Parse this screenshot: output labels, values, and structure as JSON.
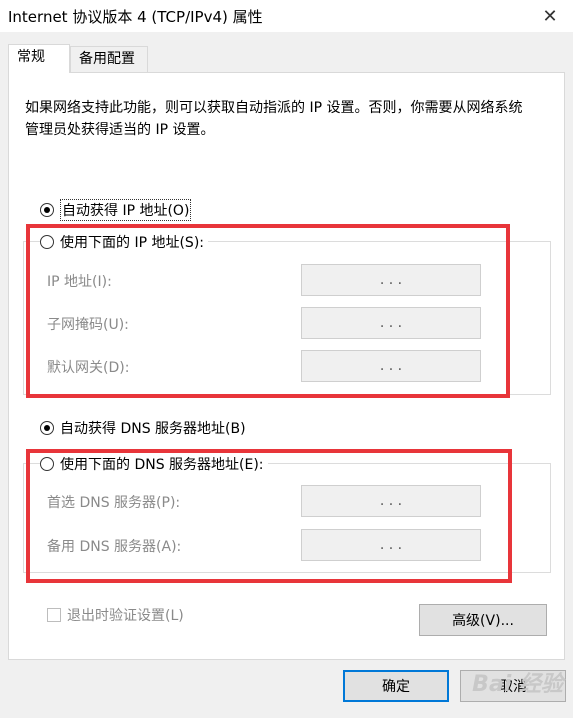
{
  "window": {
    "title": "Internet 协议版本 4 (TCP/IPv4) 属性",
    "close_glyph": "✕"
  },
  "tabs": [
    {
      "label": "常规"
    },
    {
      "label": "备用配置"
    }
  ],
  "description": "如果网络支持此功能，则可以获取自动指派的 IP 设置。否则，你需要从网络系统管理员处获得适当的 IP 设置。",
  "ip": {
    "auto_label": "自动获得 IP 地址(O)",
    "manual_label": "使用下面的 IP 地址(S):",
    "fields": [
      {
        "label": "IP 地址(I):",
        "value": ".   .   ."
      },
      {
        "label": "子网掩码(U):",
        "value": ".   .   ."
      },
      {
        "label": "默认网关(D):",
        "value": ".   .   ."
      }
    ]
  },
  "dns": {
    "auto_label": "自动获得 DNS 服务器地址(B)",
    "manual_label": "使用下面的 DNS 服务器地址(E):",
    "fields": [
      {
        "label": "首选 DNS 服务器(P):",
        "value": ".   .   ."
      },
      {
        "label": "备用 DNS 服务器(A):",
        "value": ".   .   ."
      }
    ]
  },
  "validate_label": "退出时验证设置(L)",
  "advanced_label": "高级(V)...",
  "ok_label": "确定",
  "cancel_label": "取消",
  "watermark": "Bai 经验",
  "colors": {
    "highlight": "#e8353a",
    "default_button_border": "#0078d7"
  }
}
